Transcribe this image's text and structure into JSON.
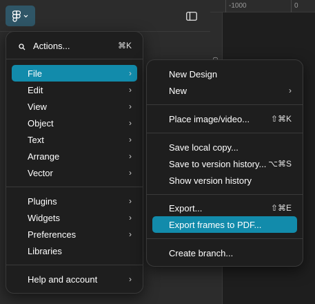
{
  "ruler": {
    "left_label": "-1000",
    "right_label": "0",
    "vertical_label": "0"
  },
  "toolbar": {
    "logo_icon": "figma-logo-icon",
    "chevron_icon": "chevron-down-icon",
    "panel_icon": "sidebar-toggle-icon"
  },
  "main_menu": {
    "actions": {
      "label": "Actions...",
      "shortcut": "⌘K"
    },
    "items": [
      {
        "label": "File",
        "arrow": "›"
      },
      {
        "label": "Edit",
        "arrow": "›"
      },
      {
        "label": "View",
        "arrow": "›"
      },
      {
        "label": "Object",
        "arrow": "›"
      },
      {
        "label": "Text",
        "arrow": "›"
      },
      {
        "label": "Arrange",
        "arrow": "›"
      },
      {
        "label": "Vector",
        "arrow": "›"
      }
    ],
    "items2": [
      {
        "label": "Plugins",
        "arrow": "›"
      },
      {
        "label": "Widgets",
        "arrow": "›"
      },
      {
        "label": "Preferences",
        "arrow": "›"
      },
      {
        "label": "Libraries",
        "arrow": ""
      }
    ],
    "help": {
      "label": "Help and account",
      "arrow": "›"
    }
  },
  "file_menu": {
    "new_design": "New Design",
    "new": {
      "label": "New",
      "arrow": "›"
    },
    "place": {
      "label": "Place image/video...",
      "shortcut": "⇧⌘K"
    },
    "save_local": "Save local copy...",
    "save_version": {
      "label": "Save to version history...",
      "shortcut": "⌥⌘S"
    },
    "show_version": "Show version history",
    "export": {
      "label": "Export...",
      "shortcut": "⇧⌘E"
    },
    "export_pdf": "Export frames to PDF...",
    "create_branch": "Create branch..."
  },
  "colors": {
    "active": "#128bab",
    "menu_bg": "#1e1e1e",
    "toolbar_bg": "#2c2c2c"
  }
}
